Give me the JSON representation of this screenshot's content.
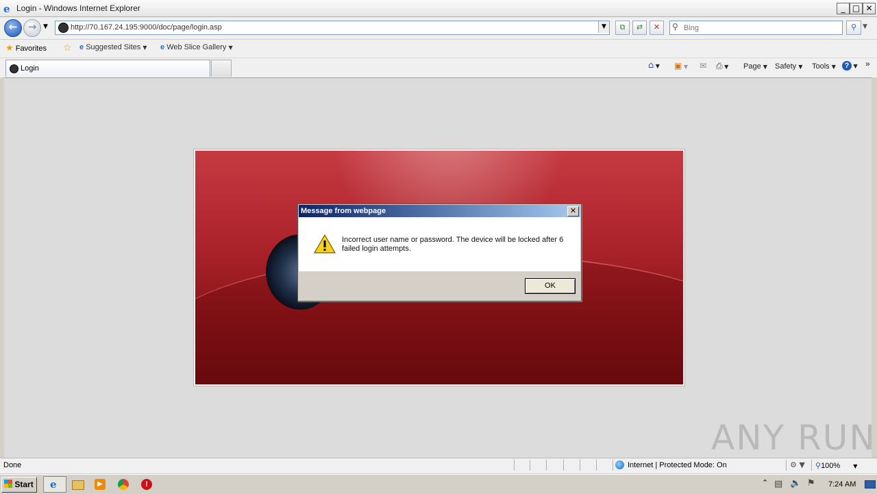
{
  "window": {
    "title": "Login - Windows Internet Explorer"
  },
  "address": {
    "url": "http://70.167.24.195:9000/doc/page/login.asp"
  },
  "search": {
    "placeholder": "Bing"
  },
  "favorites": {
    "label": "Favorites",
    "items": [
      "Suggested Sites",
      "Web Slice Gallery"
    ]
  },
  "tabs": [
    {
      "label": "Login"
    }
  ],
  "commandbar": {
    "page": "Page",
    "safety": "Safety",
    "tools": "Tools"
  },
  "dialog": {
    "title": "Message from webpage",
    "message": "Incorrect user name or password. The device will be locked after 6 failed login attempts.",
    "ok_label": "OK"
  },
  "status": {
    "text": "Done",
    "zone": "Internet | Protected Mode: On",
    "zoom": "100%"
  },
  "taskbar": {
    "start_label": "Start",
    "clock": "7:24 AM"
  },
  "watermark": "ANY RUN",
  "colors": {
    "login_panel": "#b1262e",
    "dialog_title": "#0a246a"
  }
}
